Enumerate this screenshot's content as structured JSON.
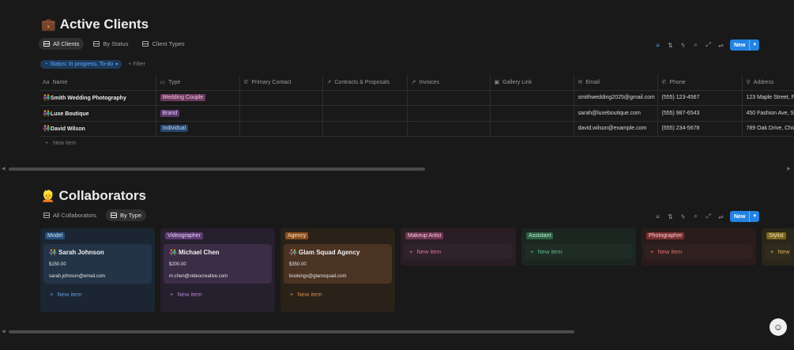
{
  "active_clients": {
    "title_icon": "briefcase-icon",
    "title": "Active Clients",
    "views": [
      {
        "label": "All Clients",
        "active": true
      },
      {
        "label": "By Status",
        "active": false
      },
      {
        "label": "Client Types",
        "active": false
      }
    ],
    "new_label": "New",
    "filter_chip": "Status: In progress, To-do",
    "add_filter": "+ Filter",
    "columns": [
      "Name",
      "Type",
      "Primary Contact",
      "Contracts & Proposals",
      "Invoices",
      "Gallery Link",
      "Email",
      "Phone",
      "Address"
    ],
    "rows": [
      {
        "name": "Smith Wedding Photography",
        "type": "Wedding Couple",
        "email": "smithwedding2025@gmail.com",
        "phone": "(555) 123-4567",
        "address": "123 Maple Street, F"
      },
      {
        "name": "Luxe Boutique",
        "type": "Brand",
        "email": "sarah@luxeboutique.com",
        "phone": "(555) 987-6543",
        "address": "450 Fashion Ave, Su"
      },
      {
        "name": "David Wilson",
        "type": "Individual",
        "email": "david.wilson@example.com",
        "phone": "(555) 234-5678",
        "address": "789 Oak Drive, Chic"
      }
    ],
    "new_item": "New item"
  },
  "collaborators": {
    "title": "Collaborators",
    "views": [
      {
        "label": "All Collaborators",
        "active": false
      },
      {
        "label": "By Type",
        "active": true
      }
    ],
    "new_label": "New",
    "columns": [
      {
        "label": "Model",
        "card": {
          "name": "Sarah Johnson",
          "rate": "$150.00",
          "email": "sarah.johnson@email.com"
        },
        "new_item": "New item"
      },
      {
        "label": "Videographer",
        "card": {
          "name": "Michael Chen",
          "rate": "$200.00",
          "email": "m.chen@videocreative.com"
        },
        "new_item": "New item"
      },
      {
        "label": "Agency",
        "card": {
          "name": "Glam Squad Agency",
          "rate": "$350.00",
          "email": "bookings@glamsquad.com"
        },
        "new_item": "New item"
      },
      {
        "label": "Makeup Artist",
        "new_item": "New item"
      },
      {
        "label": "Assistant",
        "new_item": "New item"
      },
      {
        "label": "Photographer",
        "new_item": "New item"
      },
      {
        "label": "Stylist",
        "new_item": "New"
      }
    ]
  },
  "colors": {
    "accent": "#2383e2",
    "background": "#191919"
  }
}
